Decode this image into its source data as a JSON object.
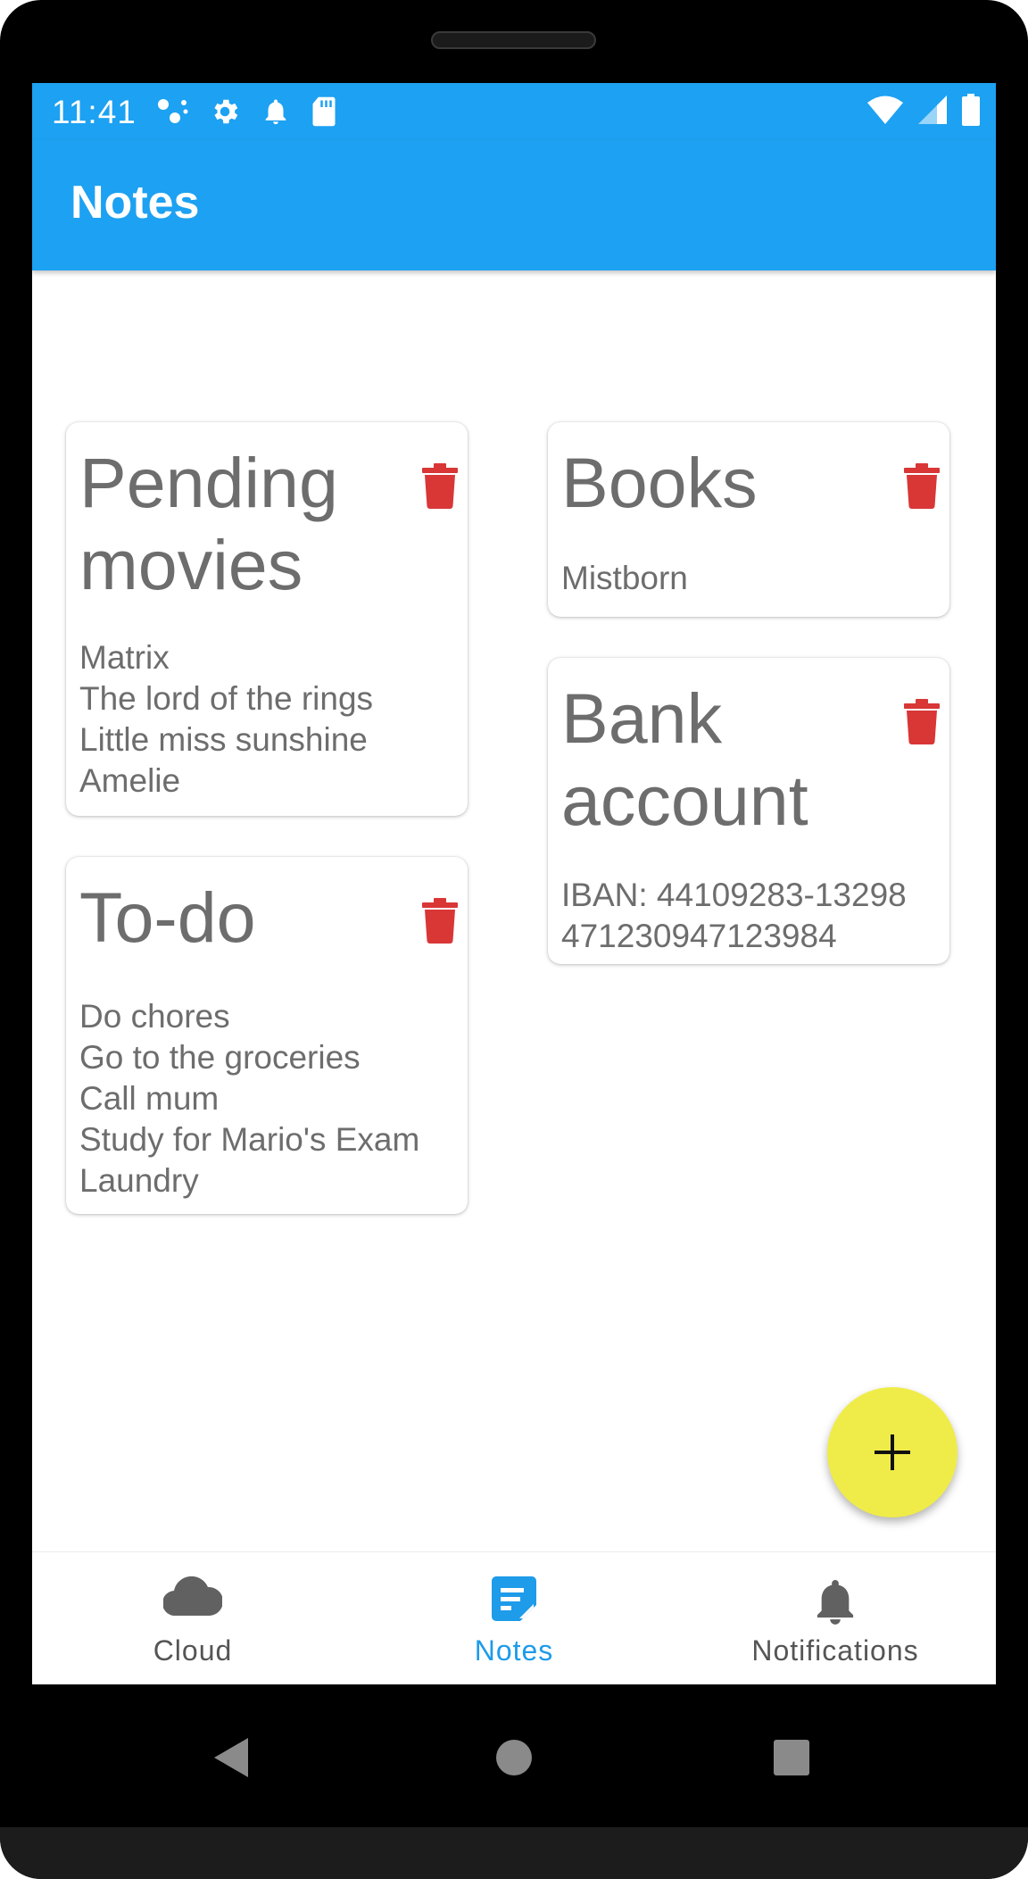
{
  "status_bar": {
    "time": "11:41",
    "icons_left": [
      "dots-icon",
      "gear-icon",
      "bell-icon",
      "sd-card-icon"
    ],
    "icons_right": [
      "wifi-icon",
      "signal-icon",
      "battery-icon"
    ]
  },
  "app_bar": {
    "title": "Notes"
  },
  "notes": [
    {
      "title_lines": [
        "Pending",
        "movies"
      ],
      "body_lines": [
        "Matrix",
        "The lord of the rings",
        "Little miss sunshine",
        "Amelie"
      ]
    },
    {
      "title_lines": [
        "To-do"
      ],
      "body_lines": [
        "Do chores",
        "Go to the groceries",
        "Call mum",
        "Study for Mario's Exam",
        "Laundry"
      ]
    },
    {
      "title_lines": [
        "Books"
      ],
      "body_lines": [
        "Mistborn"
      ]
    },
    {
      "title_lines": [
        "Bank",
        "account"
      ],
      "body_lines": [
        "IBAN: 44109283-13298",
        "471230947123984"
      ]
    }
  ],
  "fab": {
    "icon": "plus-icon"
  },
  "bottom_nav": {
    "items": [
      {
        "label": "Cloud",
        "icon": "cloud-icon"
      },
      {
        "label": "Notes",
        "icon": "notes-icon",
        "active": true
      },
      {
        "label": "Notifications",
        "icon": "bell-icon"
      }
    ]
  },
  "system_nav": [
    "back-icon",
    "home-icon",
    "recents-icon"
  ],
  "colors": {
    "primary": "#1da1f2",
    "delete": "#d93636",
    "fab": "#efec49",
    "text": "#6d6d6d",
    "nav_active": "#1e9be9",
    "nav_inactive": "#555555"
  }
}
